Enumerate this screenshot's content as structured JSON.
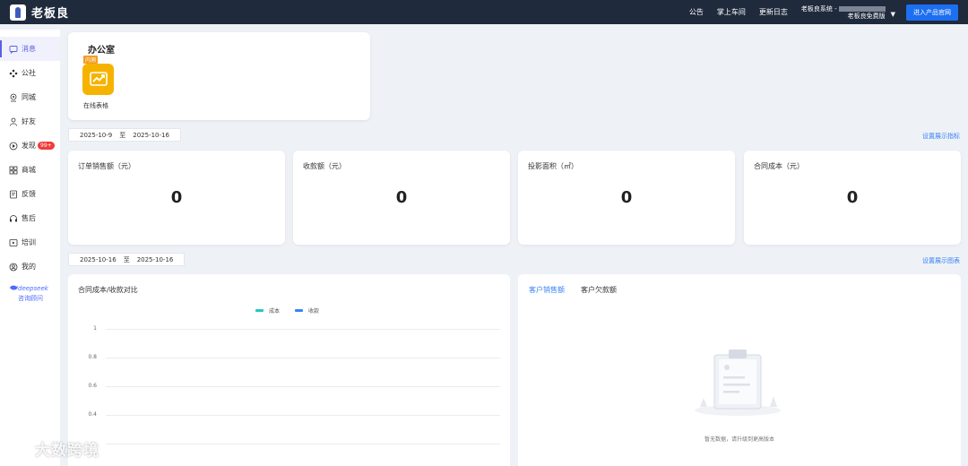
{
  "topbar": {
    "brand": "老板良",
    "links": [
      "公告",
      "掌上车间",
      "更新日志"
    ],
    "account_line1": "老板良系统 -",
    "account_line2": "老板良免费版",
    "enter_button": "进入产品官网"
  },
  "sidebar": {
    "items": [
      {
        "label": "消息",
        "icon": "message-icon",
        "active": true
      },
      {
        "label": "公社",
        "icon": "community-icon"
      },
      {
        "label": "同城",
        "icon": "location-icon"
      },
      {
        "label": "好友",
        "icon": "friend-icon"
      },
      {
        "label": "发现",
        "icon": "discover-icon",
        "badge": "99+"
      },
      {
        "label": "商城",
        "icon": "mall-icon"
      },
      {
        "label": "反馈",
        "icon": "feedback-icon"
      },
      {
        "label": "售后",
        "icon": "headset-icon"
      },
      {
        "label": "培训",
        "icon": "training-icon"
      },
      {
        "label": "我的",
        "icon": "profile-icon"
      }
    ],
    "deepseek_name": "deepseek",
    "deepseek_sub": "咨询顾问"
  },
  "office": {
    "title": "办公室",
    "beta_tag": "内测",
    "app_label": "在线表格",
    "app_icon": "chart-up-icon",
    "app_color": "#f5b300"
  },
  "date_range_1": {
    "start": "2025-10-9",
    "sep": "至",
    "end": "2025-10-16"
  },
  "settings_metrics": "设置展示指标",
  "stats": [
    {
      "label": "订单销售额（元）",
      "value": "0"
    },
    {
      "label": "收款额（元）",
      "value": "0"
    },
    {
      "label": "投影面积（㎡）",
      "value": "0"
    },
    {
      "label": "合同成本（元）",
      "value": "0"
    }
  ],
  "date_range_2": {
    "start": "2025-10-16",
    "sep": "至",
    "end": "2025-10-16"
  },
  "settings_charts": "设置展示图表",
  "chart_data": {
    "type": "line",
    "title": "合同成本/收款对比",
    "series": [
      {
        "name": "成本",
        "color": "#1fc8c8",
        "values": []
      },
      {
        "name": "收款",
        "color": "#3a82f7",
        "values": []
      }
    ],
    "yticks": [
      "1",
      "0.8",
      "0.6",
      "0.4"
    ],
    "ylim": [
      0,
      1
    ],
    "grid": true,
    "legend": "top-center"
  },
  "sales_tabs": [
    {
      "label": "客户销售额",
      "active": true
    },
    {
      "label": "客户欠款额"
    }
  ],
  "empty_text": "暂无数据，请升级到更高版本",
  "watermark": "大数跨境"
}
